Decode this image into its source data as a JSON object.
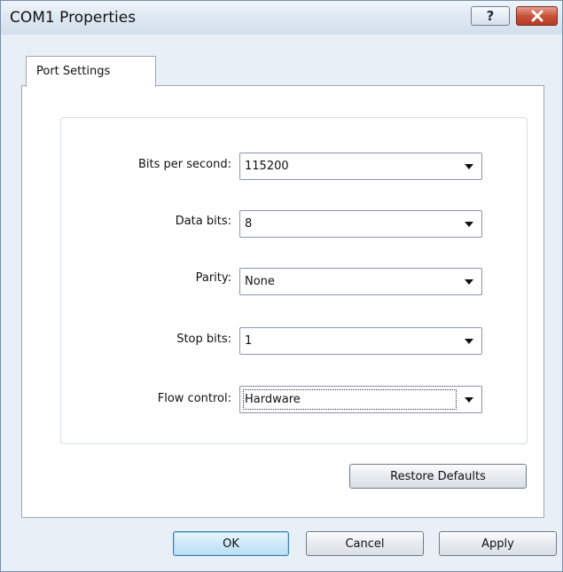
{
  "window": {
    "title": "COM1 Properties"
  },
  "titlebar": {
    "help_label": "?",
    "close_icon": "close-icon"
  },
  "tabs": [
    {
      "label": "Port Settings",
      "selected": true
    }
  ],
  "fields": [
    {
      "label": "Bits per second:",
      "value": "115200"
    },
    {
      "label": "Data bits:",
      "value": "8"
    },
    {
      "label": "Parity:",
      "value": "None"
    },
    {
      "label": "Stop bits:",
      "value": "1"
    },
    {
      "label": "Flow control:",
      "value": "Hardware"
    }
  ],
  "buttons": {
    "restore_defaults": "Restore Defaults",
    "ok": "OK",
    "cancel": "Cancel",
    "apply": "Apply"
  },
  "colors": {
    "titlebar": "#dde7f2",
    "close_button": "#c9523b",
    "ok_button_border": "#3c7fb1"
  }
}
